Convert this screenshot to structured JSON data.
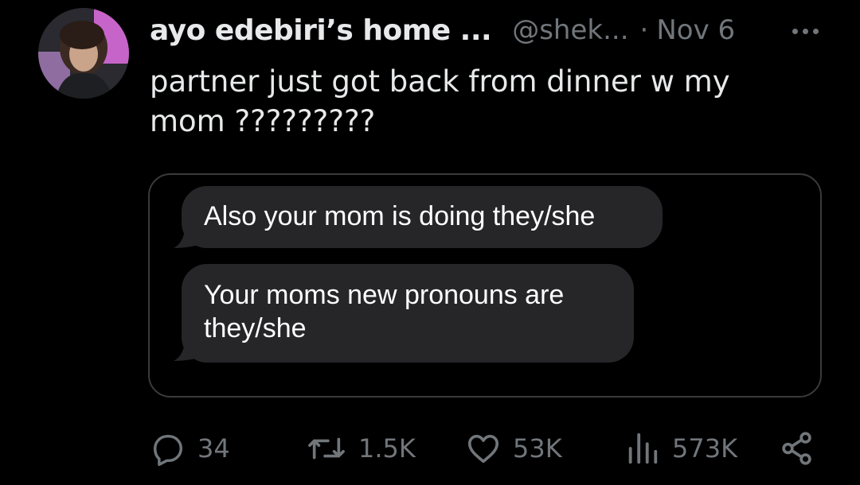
{
  "tweet": {
    "display_name": "ayo edebiri’s home ...",
    "handle": "@shek...",
    "separator": "·",
    "date": "Nov 6",
    "text": "partner just got back from dinner w my mom ?????????"
  },
  "screenshot_messages": [
    {
      "text": "Also your mom is doing they/she"
    },
    {
      "text": "Your moms new pronouns are they/she"
    }
  ],
  "actions": {
    "replies": "34",
    "reposts": "1.5K",
    "likes": "53K",
    "views": "573K"
  },
  "icons": {
    "more": "more-icon",
    "reply": "reply-icon",
    "repost": "repost-icon",
    "like": "heart-icon",
    "views": "views-icon",
    "share": "share-icon"
  },
  "colors": {
    "background": "#000000",
    "text": "#e7e9ea",
    "secondary": "#71767b",
    "bubble": "#262628",
    "media_border": "#3a3a3a"
  }
}
